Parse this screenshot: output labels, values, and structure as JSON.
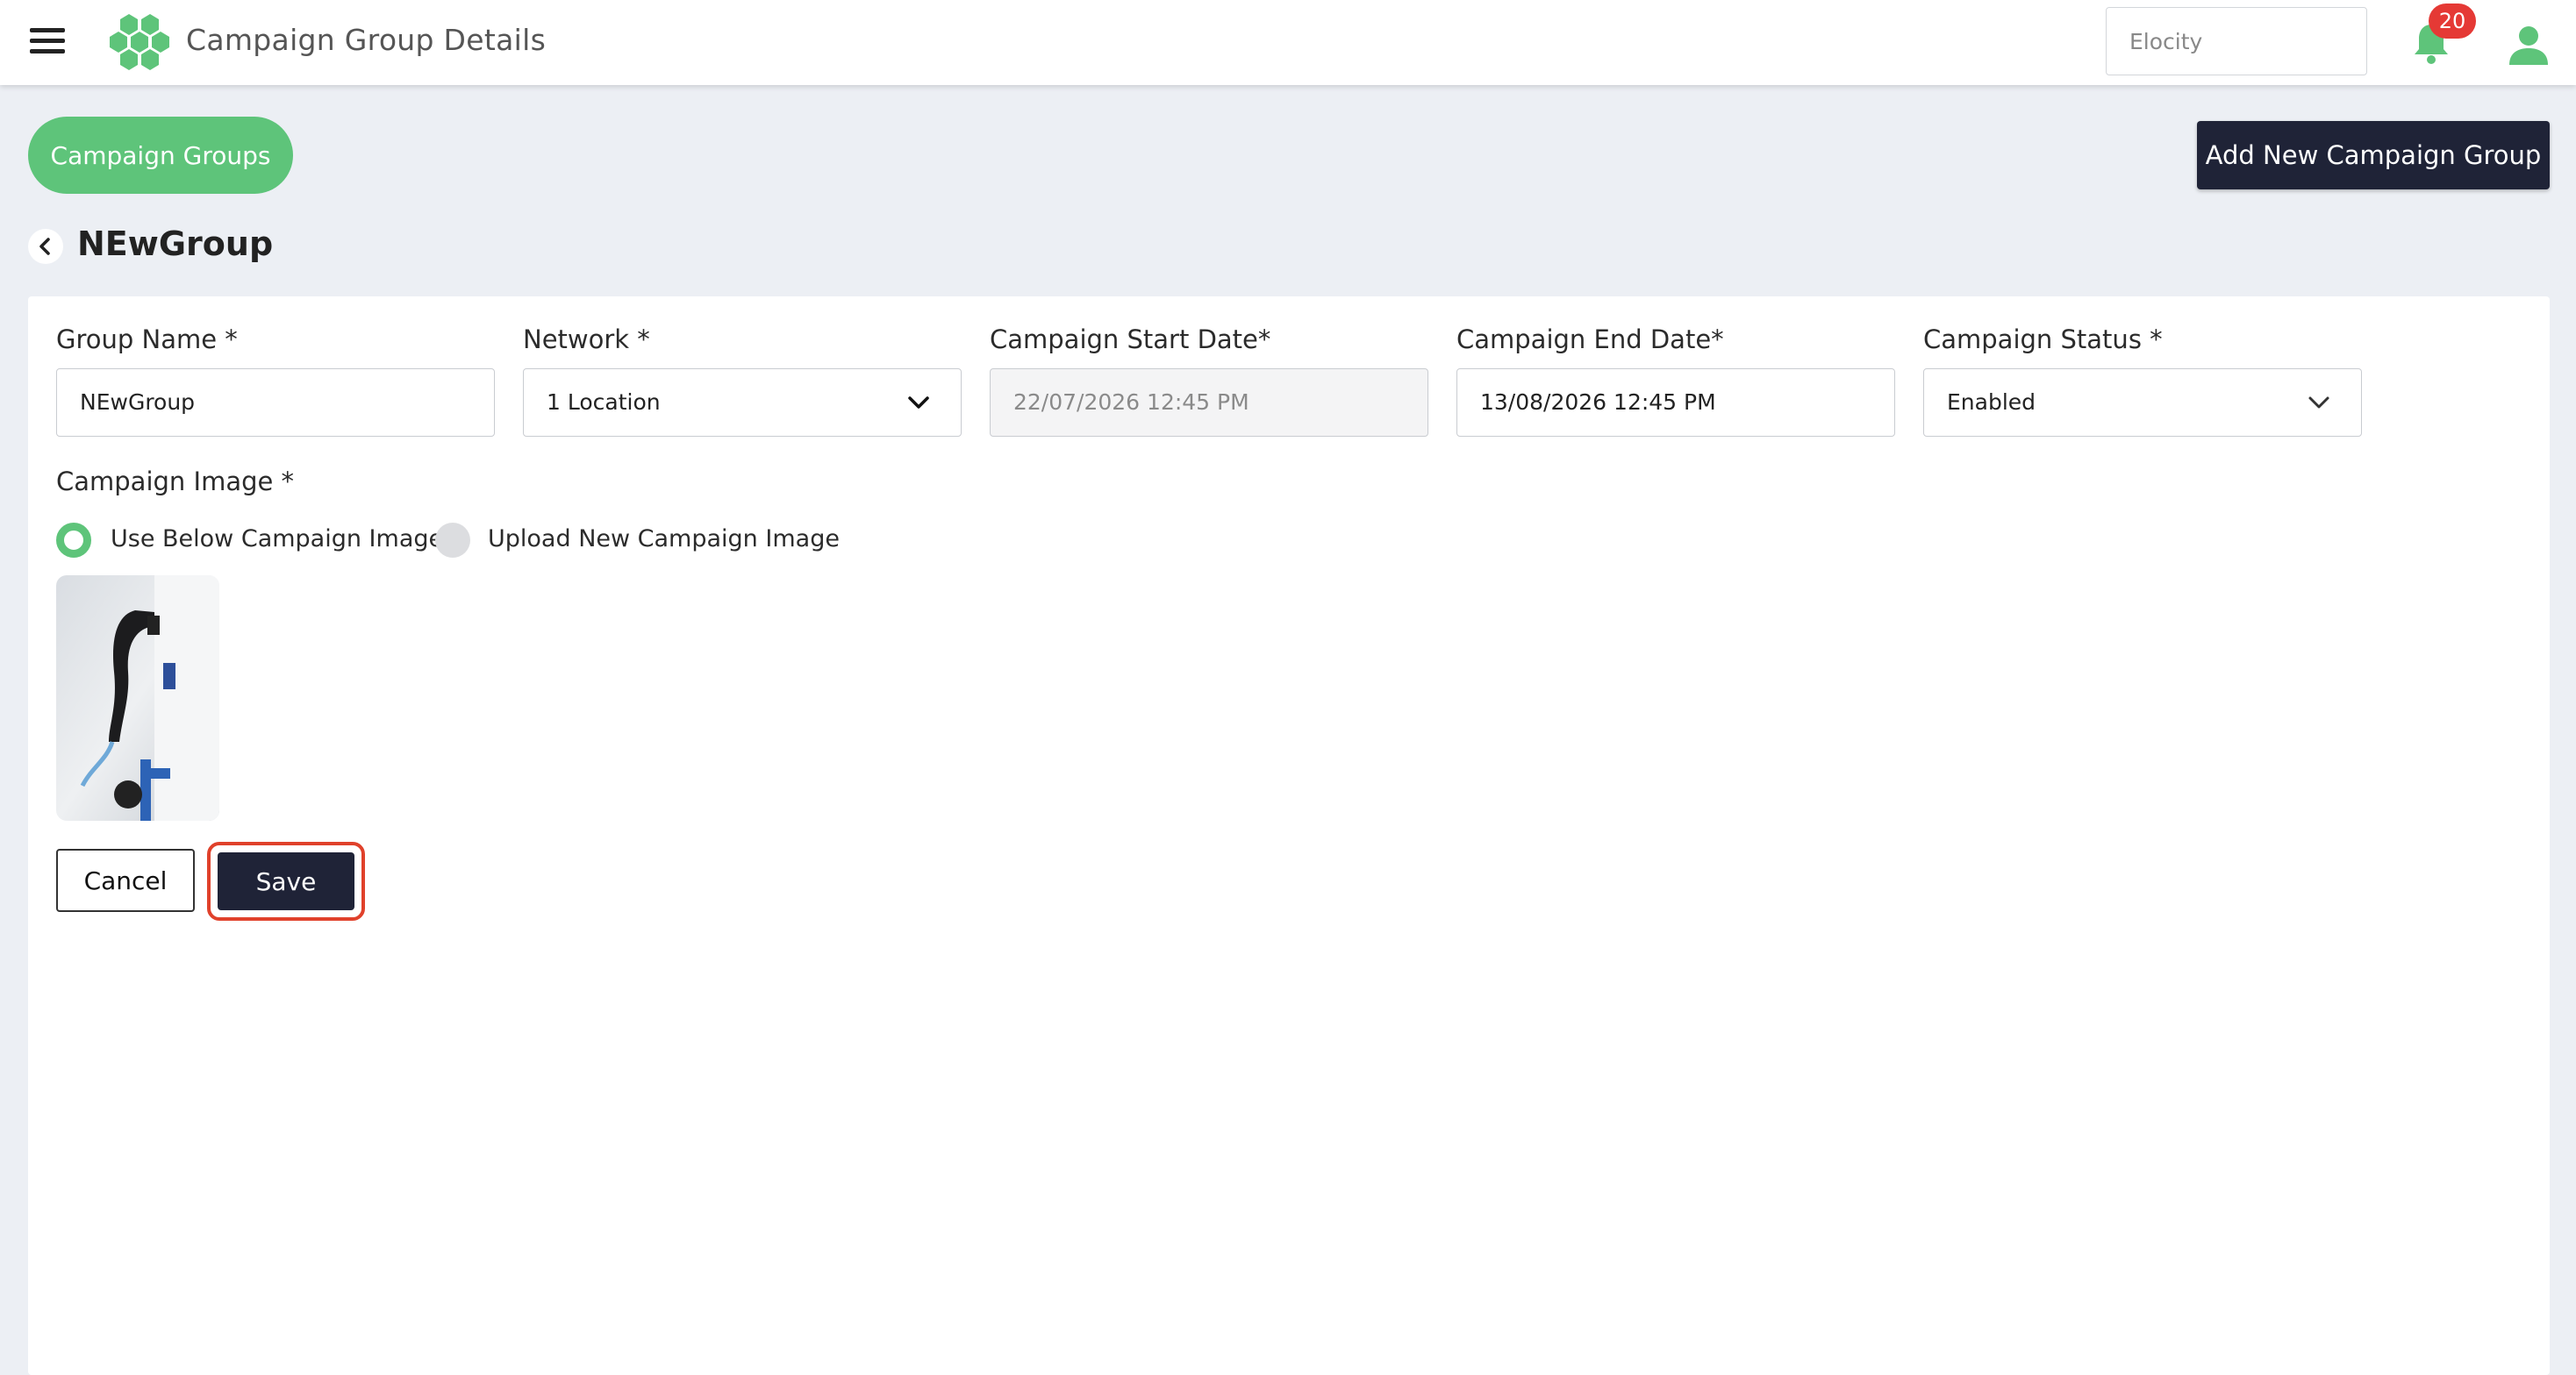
{
  "header": {
    "title": "Campaign Group Details",
    "org_value": "Elocity",
    "notification_count": "20",
    "brand_color": "#5ec47a",
    "icons": [
      "menu-icon",
      "hexagon-logo-icon",
      "bell-icon",
      "user-icon"
    ]
  },
  "toolbar": {
    "campaign_groups_label": "Campaign Groups",
    "add_new_label": "Add New Campaign Group"
  },
  "page": {
    "title": "NEwGroup"
  },
  "form": {
    "group_name": {
      "label": "Group Name *",
      "value": "NEwGroup"
    },
    "network": {
      "label": "Network *",
      "value": "1 Location"
    },
    "start_date": {
      "label": "Campaign Start Date*",
      "value": "22/07/2026 12:45 PM"
    },
    "end_date": {
      "label": "Campaign End Date*",
      "value": "13/08/2026 12:45 PM"
    },
    "status": {
      "label": "Campaign Status *",
      "value": "Enabled"
    },
    "image": {
      "label": "Campaign Image *",
      "option_existing": "Use Below Campaign Image",
      "option_upload": "Upload New Campaign Image",
      "selected": "existing"
    }
  },
  "actions": {
    "cancel_label": "Cancel",
    "save_label": "Save"
  }
}
